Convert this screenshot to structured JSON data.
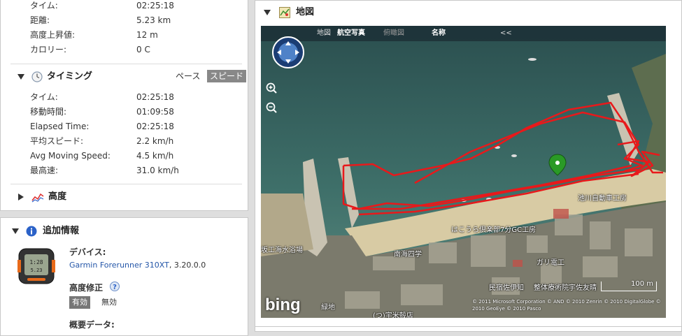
{
  "summary": {
    "rows": [
      {
        "label": "タイム:",
        "value": "02:25:18"
      },
      {
        "label": "距離:",
        "value": "5.23 km"
      },
      {
        "label": "高度上昇値:",
        "value": "12 m"
      },
      {
        "label": "カロリー:",
        "value": "0 C"
      }
    ]
  },
  "timing": {
    "title": "タイミング",
    "pace_label": "ペース",
    "speed_label": "スピード",
    "rows": [
      {
        "label": "タイム:",
        "value": "02:25:18"
      },
      {
        "label": "移動時間:",
        "value": "01:09:58"
      },
      {
        "label": "Elapsed Time:",
        "value": "02:25:18"
      },
      {
        "label": "平均スピード:",
        "value": "2.2 km/h"
      },
      {
        "label": "Avg Moving Speed:",
        "value": "4.5 km/h"
      },
      {
        "label": "最高速:",
        "value": "31.0 km/h"
      }
    ]
  },
  "elevation": {
    "title": "高度"
  },
  "extra": {
    "title": "追加情報",
    "device_label": "デバイス:",
    "device_name": "Garmin Forerunner 310XT",
    "device_version": ", 3.20.0.0",
    "elev_correction_label": "高度修正",
    "enabled_label": "有効",
    "disabled_label": "無効",
    "overview_label": "概要データ:"
  },
  "map": {
    "title": "地図",
    "nav": {
      "map": "地図",
      "aerial": "航空写真",
      "birdseye": "俯瞰図",
      "labels": "名称",
      "collapse": "<<"
    },
    "places": [
      "池川自動車工房",
      "はこうら倶楽部7分GC工房",
      "南海四学",
      "坂工海水浴場",
      "ガリ電工",
      "民宿佐伊知",
      "整体療術院宇佐友晴",
      "(つ)宇米殻店",
      "緑地"
    ],
    "scale": "100 m",
    "copyright": "© 2011 Microsoft Corporation  © AND  © 2010 Zenrin  © 2010 DigitalGlobe  © 2010 GeoEye  © 2010 Pasco",
    "bing": "bing",
    "colors": {
      "track": "#e8191b",
      "sea": "#2e5c57",
      "beach": "#d8cba4"
    }
  }
}
